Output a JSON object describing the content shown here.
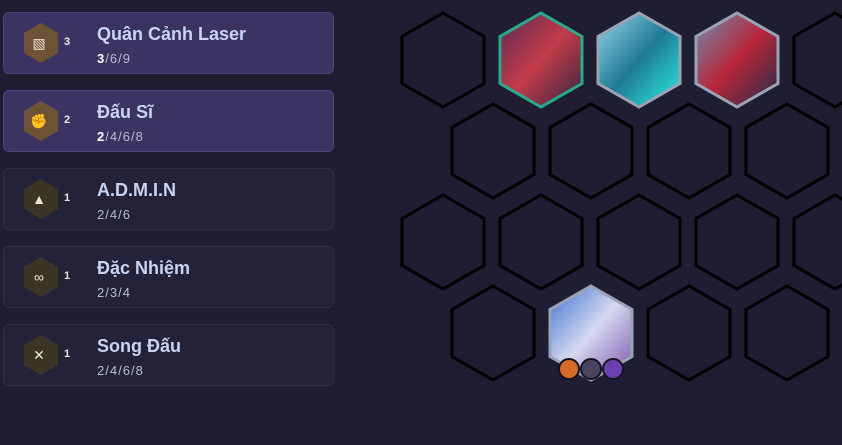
{
  "traits": [
    {
      "name": "Quân Cảnh Laser",
      "count": "3",
      "icon": "broken-image-icon",
      "steps": [
        "3",
        "6",
        "9"
      ],
      "active_step": 0,
      "active": true
    },
    {
      "name": "Đấu Sĩ",
      "count": "2",
      "icon": "fist-icon",
      "steps": [
        "2",
        "4",
        "6",
        "8"
      ],
      "active_step": 0,
      "active": true
    },
    {
      "name": "A.D.M.I.N",
      "count": "1",
      "icon": "drop-triangle-icon",
      "steps": [
        "2",
        "4",
        "6"
      ],
      "active_step": -1,
      "active": false
    },
    {
      "name": "Đặc Nhiệm",
      "count": "1",
      "icon": "binoculars-icon",
      "steps": [
        "2",
        "3",
        "4"
      ],
      "active_step": -1,
      "active": false
    },
    {
      "name": "Song Đấu",
      "count": "1",
      "icon": "crossed-swords-icon",
      "steps": [
        "2",
        "4",
        "6",
        "8"
      ],
      "active_step": -1,
      "active": false
    }
  ],
  "board": {
    "champions": [
      {
        "slot": "r0c1",
        "name": "champion-red-mech",
        "border": "#2aa88a",
        "colors": [
          "#5a2a55",
          "#c33b4a",
          "#30263d"
        ]
      },
      {
        "slot": "r0c2",
        "name": "champion-ice-robot",
        "border": "#9aa3b5",
        "colors": [
          "#9bd6ee",
          "#1f7a93",
          "#2bf0e0"
        ]
      },
      {
        "slot": "r0c3",
        "name": "champion-red-drone",
        "border": "#9aa3b5",
        "colors": [
          "#6a8fb0",
          "#b8263a",
          "#1e2c46"
        ]
      },
      {
        "slot": "r3c1",
        "name": "champion-silver-hair",
        "border": "#9aa3b5",
        "colors": [
          "#3e6fd0",
          "#d5d9f0",
          "#7a4fa8"
        ]
      }
    ],
    "items": [
      {
        "name": "item-orange-icon",
        "color": "#d56a2a"
      },
      {
        "name": "item-dark-icon",
        "color": "#4a4460"
      },
      {
        "name": "item-purple-icon",
        "color": "#6b3fb2"
      }
    ]
  }
}
